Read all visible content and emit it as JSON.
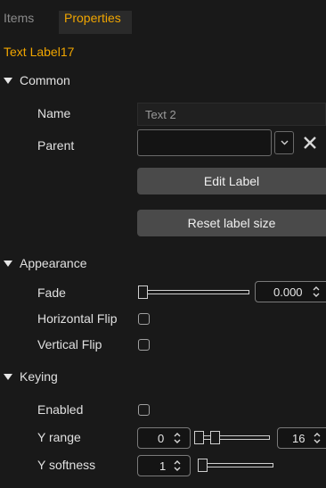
{
  "tabs": [
    {
      "label": "Items"
    },
    {
      "label": "Properties"
    }
  ],
  "object_title": "Text Label17",
  "sections": {
    "common": {
      "label": "Common",
      "name_label": "Name",
      "name_value": "Text 2",
      "parent_label": "Parent",
      "parent_value": "",
      "edit_label_button": "Edit Label",
      "reset_label_size_button": "Reset label size"
    },
    "appearance": {
      "label": "Appearance",
      "fade_label": "Fade",
      "fade_value": "0.000",
      "fade_slider_level": 0,
      "horizontal_flip_label": "Horizontal Flip",
      "horizontal_flip_checked": false,
      "vertical_flip_label": "Vertical Flip",
      "vertical_flip_checked": false
    },
    "keying": {
      "label": "Keying",
      "enabled_label": "Enabled",
      "enabled_checked": false,
      "y_range_label": "Y range",
      "y_range_min": "0",
      "y_range_max": "16",
      "y_softness_label": "Y softness",
      "y_softness_value": "1"
    }
  },
  "colors": {
    "background": "#191919",
    "accent": "#f0a500",
    "button": "#4a4a4a",
    "text": "#e0e0e0"
  },
  "icons": {
    "collapse": "triangle-down-icon",
    "dropdown": "chevron-down-icon",
    "clear": "close-icon",
    "spin": "up-down-arrows-icon"
  }
}
